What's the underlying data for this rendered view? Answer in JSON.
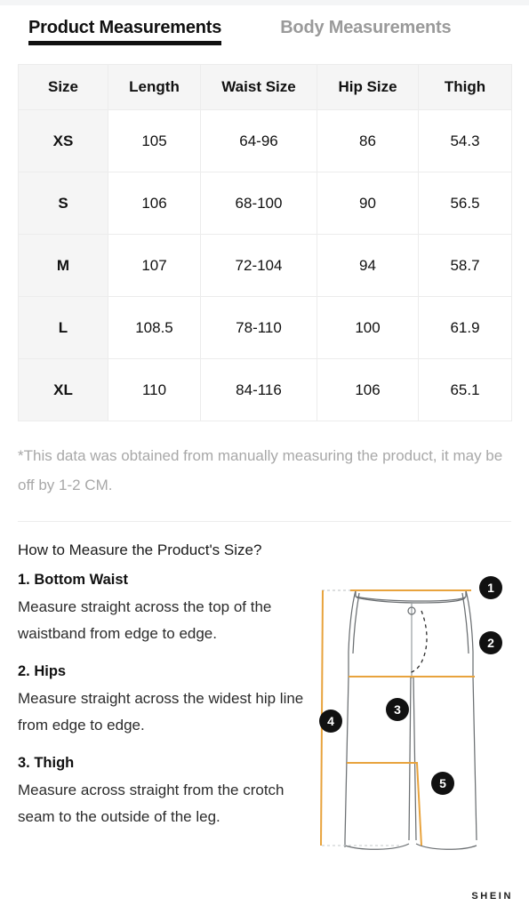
{
  "tabs": [
    {
      "label": "Product Measurements",
      "active": true
    },
    {
      "label": "Body Measurements",
      "active": false
    }
  ],
  "table": {
    "headers": [
      "Size",
      "Length",
      "Waist Size",
      "Hip Size",
      "Thigh"
    ],
    "rows": [
      {
        "size": "XS",
        "length": "105",
        "waist": "64-96",
        "hip": "86",
        "thigh": "54.3"
      },
      {
        "size": "S",
        "length": "106",
        "waist": "68-100",
        "hip": "90",
        "thigh": "56.5"
      },
      {
        "size": "M",
        "length": "107",
        "waist": "72-104",
        "hip": "94",
        "thigh": "58.7"
      },
      {
        "size": "L",
        "length": "108.5",
        "waist": "78-110",
        "hip": "100",
        "thigh": "61.9"
      },
      {
        "size": "XL",
        "length": "110",
        "waist": "84-116",
        "hip": "106",
        "thigh": "65.1"
      }
    ]
  },
  "disclaimer": "*This data was obtained from manually measuring the product, it may be off by 1-2 CM.",
  "howto": {
    "title": "How to Measure the Product's Size?",
    "steps": [
      {
        "title": "1. Bottom Waist",
        "text": "Measure straight across the top of the waistband from edge to edge."
      },
      {
        "title": "2. Hips",
        "text": "Measure straight across the widest hip line from edge to edge."
      },
      {
        "title": "3. Thigh",
        "text": "Measure across straight from the crotch seam to the outside of the leg."
      }
    ]
  },
  "diagram": {
    "badges": [
      "1",
      "2",
      "3",
      "4",
      "5"
    ],
    "badge_1": "1",
    "badge_2": "2",
    "badge_3": "3",
    "badge_4": "4",
    "badge_5": "5"
  },
  "brand": "SHEIN",
  "colors": {
    "accent_measure_line": "#e8a33d",
    "garment_outline": "#6b6f72",
    "badge_bg": "#111111",
    "tab_active": "#111111",
    "tab_inactive": "#9a9a9a",
    "table_header_bg": "#f5f5f5",
    "table_border": "#ececec",
    "disclaimer_text": "#a8a8a8"
  }
}
